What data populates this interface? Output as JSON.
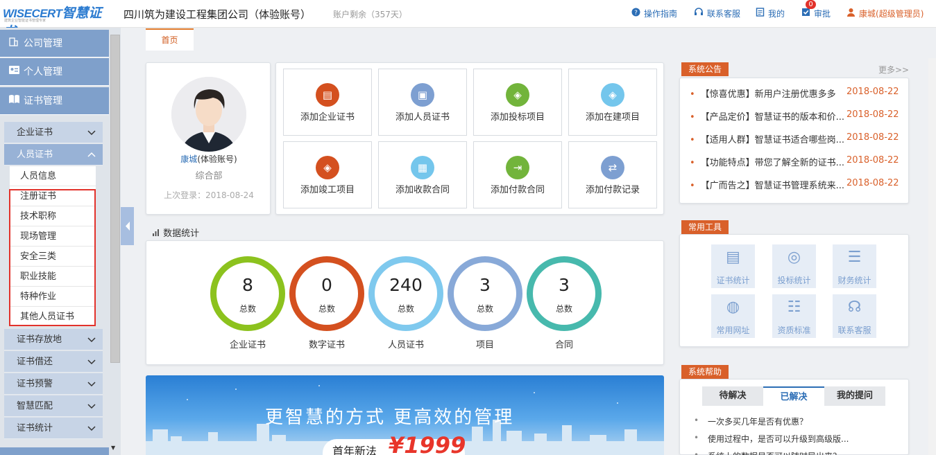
{
  "header": {
    "logo_en": "WISECERT",
    "logo_cn": "智慧证书",
    "logo_sub": "建筑企业智能证书管理专家",
    "company": "四川筑为建设工程集团公司（体验账号）",
    "account_left": "账户剩余（357天）",
    "nav": [
      {
        "label": "操作指南",
        "icon": "help-icon"
      },
      {
        "label": "联系客服",
        "icon": "headset-icon"
      },
      {
        "label": "我的",
        "icon": "document-icon"
      },
      {
        "label": "审批",
        "icon": "check-icon",
        "badge": "0"
      },
      {
        "label": "康城",
        "extra": "(超级管理员)",
        "icon": "user-icon"
      }
    ]
  },
  "sidebar": {
    "top": [
      {
        "label": "公司管理",
        "icon": "building-icon"
      },
      {
        "label": "个人管理",
        "icon": "id-card-icon"
      },
      {
        "label": "证书管理",
        "icon": "book-icon"
      }
    ],
    "groups_a": [
      {
        "label": "企业证书",
        "chev": "∨"
      },
      {
        "label": "人员证书",
        "chev": "∧"
      }
    ],
    "subs": [
      "人员信息",
      "注册证书",
      "技术职称",
      "现场管理",
      "安全三类",
      "职业技能",
      "特种作业",
      "其他人员证书"
    ],
    "groups_b": [
      "证书存放地",
      "证书借还",
      "证书预警",
      "智慧匹配",
      "证书统计"
    ]
  },
  "tabs": [
    "首页"
  ],
  "profile": {
    "name": "康城",
    "tag": "(体验账号)",
    "dept": "综合部",
    "last_login": "上次登录：2018-08-24"
  },
  "quick": [
    {
      "label": "添加企业证书",
      "color": "#d4501f",
      "icon": "certificate-icon",
      "glyph": "▤"
    },
    {
      "label": "添加人员证书",
      "color": "#7d9fd1",
      "icon": "person-card-icon",
      "glyph": "▣"
    },
    {
      "label": "添加投标项目",
      "color": "#72b43b",
      "icon": "box-icon",
      "glyph": "◈"
    },
    {
      "label": "添加在建项目",
      "color": "#74c6ec",
      "icon": "cube-icon",
      "glyph": "◈"
    },
    {
      "label": "添加竣工项目",
      "color": "#d4501f",
      "icon": "cube-done-icon",
      "glyph": "◈"
    },
    {
      "label": "添加收款合同",
      "color": "#74c6ec",
      "icon": "calculator-icon",
      "glyph": "▦"
    },
    {
      "label": "添加付款合同",
      "color": "#72b43b",
      "icon": "export-icon",
      "glyph": "⇥"
    },
    {
      "label": "添加付款记录",
      "color": "#7d9fd1",
      "icon": "transfer-icon",
      "glyph": "⇄"
    }
  ],
  "stats": {
    "title": "数据统计",
    "items": [
      {
        "value": "8",
        "sub": "总数",
        "label": "企业证书",
        "color": "#8cc21e"
      },
      {
        "value": "0",
        "sub": "总数",
        "label": "数字证书",
        "color": "#d4501f"
      },
      {
        "value": "240",
        "sub": "总数",
        "label": "人员证书",
        "color": "#7fc9ee"
      },
      {
        "value": "3",
        "sub": "总数",
        "label": "项目",
        "color": "#88a9d8"
      },
      {
        "value": "3",
        "sub": "总数",
        "label": "合同",
        "color": "#47b9ad"
      }
    ]
  },
  "banner": {
    "slogan": "更智慧的方式 更高效的管理",
    "promo": "首年新法",
    "price": "¥1999"
  },
  "announcements": {
    "title": "系统公告",
    "more": "更多>>",
    "items": [
      {
        "text": "【惊喜优惠】新用户注册优惠多多",
        "date": "2018-08-22"
      },
      {
        "text": "【产品定价】智慧证书的版本和价...",
        "date": "2018-08-22"
      },
      {
        "text": "【适用人群】智慧证书适合哪些岗...",
        "date": "2018-08-22"
      },
      {
        "text": "【功能特点】带您了解全新的证书...",
        "date": "2018-08-22"
      },
      {
        "text": "【广而告之】智慧证书管理系统来...",
        "date": "2018-08-22"
      }
    ]
  },
  "tools": {
    "title": "常用工具",
    "items": [
      {
        "label": "证书统计",
        "icon": "cert-stats-icon",
        "glyph": "▤"
      },
      {
        "label": "投标统计",
        "icon": "target-icon",
        "glyph": "◎"
      },
      {
        "label": "财务统计",
        "icon": "coins-icon",
        "glyph": "☰"
      },
      {
        "label": "常用网址",
        "icon": "planet-icon",
        "glyph": "◍"
      },
      {
        "label": "资质标准",
        "icon": "database-icon",
        "glyph": "☷"
      },
      {
        "label": "联系客服",
        "icon": "headset-icon",
        "glyph": "☊"
      }
    ]
  },
  "help": {
    "title": "系统帮助",
    "tabs": [
      "待解决",
      "已解决",
      "我的提问"
    ],
    "items": [
      "一次多买几年是否有优惠？",
      "使用过程中，是否可以升级到高级版...",
      "系统上的数据是否可以随时导出来？"
    ]
  }
}
